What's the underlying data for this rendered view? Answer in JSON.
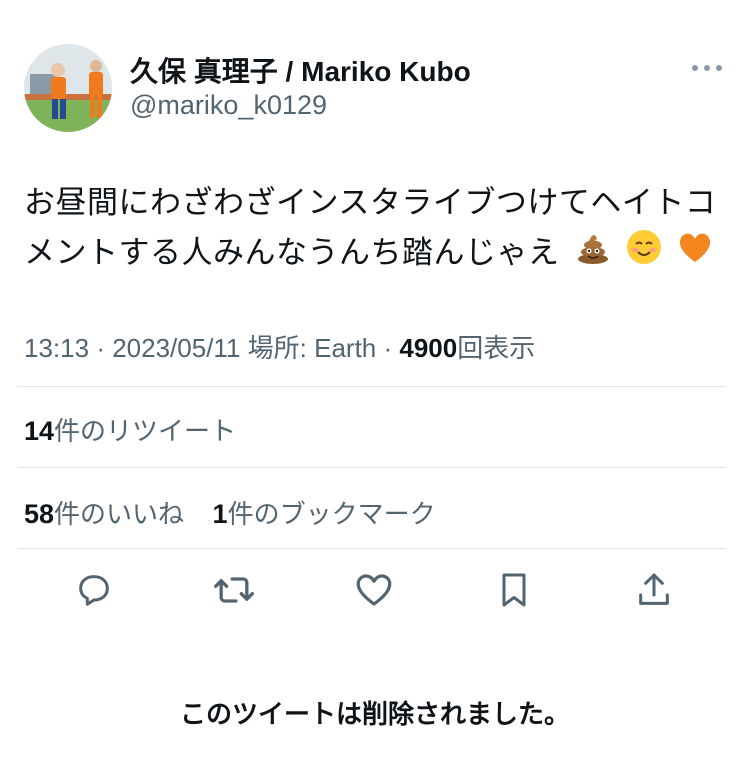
{
  "author": {
    "display_name": "久保 真理子 / Mariko Kubo",
    "handle": "@mariko_k0129"
  },
  "tweet": {
    "text": "お昼間にわざわざインスタライブつけてヘイトコメントする人みんなうんち踏んじゃえ",
    "emojis": [
      "pile-of-poo",
      "smiling-face",
      "orange-heart"
    ]
  },
  "meta": {
    "time": "13:13",
    "sep1": "·",
    "date": "2023/05/11",
    "location_label": "場所: Earth",
    "sep2": "·",
    "views_count": "4900",
    "views_label": "回表示"
  },
  "stats": {
    "retweets_count": "14",
    "retweets_label": "件のリツイート",
    "likes_count": "58",
    "likes_label": "件のいいね",
    "bookmarks_count": "1",
    "bookmarks_label": "件のブックマーク"
  },
  "actions": [
    "reply-icon",
    "retweet-icon",
    "like-icon",
    "bookmark-icon",
    "share-icon"
  ],
  "footer": {
    "deleted_notice": "このツイートは削除されました。"
  },
  "colors": {
    "text": "#0f1419",
    "secondary": "#536471",
    "divider": "#e1e6ea",
    "icon": "#536471"
  }
}
